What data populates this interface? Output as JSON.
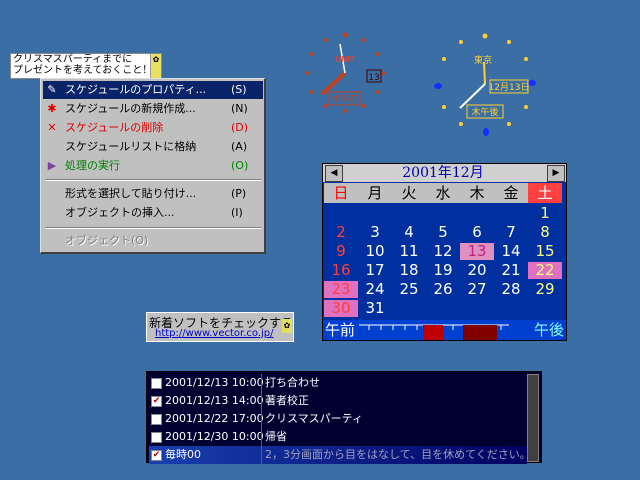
{
  "note": {
    "line1": "クリスマスパーティまでに",
    "line2": "プレゼントを考えておくこと！",
    "icon": "✿"
  },
  "menu": {
    "items": [
      {
        "label": "スケジュールのプロパティ...",
        "key": "(S)",
        "icon": "✎",
        "style": "sel"
      },
      {
        "label": "スケジュールの新規作成...",
        "key": "(N)",
        "icon": "✱",
        "style": ""
      },
      {
        "label": "スケジュールの削除",
        "key": "(D)",
        "icon": "✕",
        "style": "red"
      },
      {
        "label": "スケジュールリストに格納",
        "key": "(A)",
        "icon": "",
        "style": ""
      },
      {
        "label": "処理の実行",
        "key": "(O)",
        "icon": "▶",
        "style": "green"
      },
      {
        "label": "形式を選択して貼り付け...",
        "key": "(P)",
        "icon": "",
        "style": ""
      },
      {
        "label": "オブジェクトの挿入...",
        "key": "(I)",
        "icon": "",
        "style": ""
      },
      {
        "label": "オブジェクト(O)",
        "key": "",
        "icon": "",
        "style": "dis"
      }
    ]
  },
  "clock1": {
    "city": "UNIT",
    "day": "13",
    "weekday": "木午前"
  },
  "clock2": {
    "city": "東京",
    "date": "12月13日",
    "weekday": "木午後"
  },
  "calendar": {
    "title": "2001年12月",
    "weekdays": [
      "日",
      "月",
      "火",
      "水",
      "木",
      "金",
      "土"
    ],
    "weeks": [
      [
        "",
        "",
        "",
        "",
        "",
        "",
        "1"
      ],
      [
        "2",
        "3",
        "4",
        "5",
        "6",
        "7",
        "8"
      ],
      [
        "9",
        "10",
        "11",
        "12",
        "13",
        "14",
        "15"
      ],
      [
        "16",
        "17",
        "18",
        "19",
        "20",
        "21",
        "22"
      ],
      [
        "23",
        "24",
        "25",
        "26",
        "27",
        "28",
        "29"
      ],
      [
        "30",
        "31",
        "",
        "",
        "",
        "",
        ""
      ]
    ],
    "am_label": "午前",
    "pm_label": "午後",
    "colors": {
      "sunday": "#ff4040",
      "saturday": "#ffff80",
      "mark": "#e070c0"
    }
  },
  "vector": {
    "title": "新着ソフトをチェックする",
    "url": "http://www.vector.co.jp/"
  },
  "schedule": [
    {
      "checked": false,
      "date": "2001/12/13 10:00",
      "text": "打ち合わせ"
    },
    {
      "checked": true,
      "date": "2001/12/13 14:00",
      "text": "著者校正"
    },
    {
      "checked": false,
      "date": "2001/12/22 17:00",
      "text": "クリスマスパーティ"
    },
    {
      "checked": false,
      "date": "2001/12/30 10:00",
      "text": "帰省"
    },
    {
      "checked": true,
      "date": "毎時00",
      "text": "2，3分画面から目をはなして、目を休めてください。"
    }
  ]
}
